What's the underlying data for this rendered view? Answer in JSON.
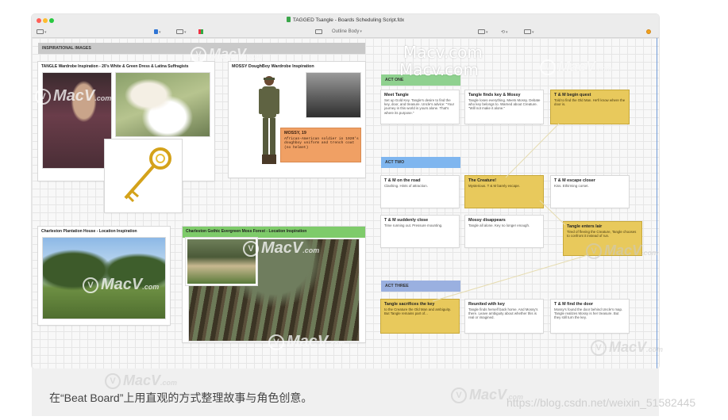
{
  "window": {
    "title": "TAGGED Tsangle - Boards Scheduling Script.fdx",
    "outline_label": "Outline Body"
  },
  "sections": {
    "inspirational": "INSPIRATIONAL IMAGES",
    "act_one": "ACT ONE",
    "act_two": "ACT TWO",
    "act_three": "ACT THREE"
  },
  "image_cards": {
    "tangle_wardrobe": "TANGLE Wardrobe Inspiration - 20's White & Green Dress & Latina Suffragists",
    "mossy_wardrobe": "MOSSY DoughBoy Wardrobe Inspiration",
    "charleston_plantation": "Charleston Plantation House - Location Inspiration",
    "charleston_gothic": "Charleston Gothic Evergreen Moss Forest - Location Inspiration"
  },
  "mossy_note": {
    "title": "MOSSY, 19",
    "body": "African-American soldier in 1920's doughboy uniform and trench coat (no helmet)"
  },
  "beats": {
    "meet_tangle": {
      "title": "Meet Tangle",
      "body": "Set up Gold Key. Tangle's desire to find the key, door, and treasure. Uncle's advice: \"Your journey in this world is yours alone. That's where its purpose.\""
    },
    "tangle_finds_key": {
      "title": "Tangle finds key & Mossy",
      "body": "Tangle loses everything. Meets Mossy. Debate who key belongs to. Warned about Creature. \"Will not make it alone.\""
    },
    "begin_quest": {
      "title": "T & M begin quest",
      "body": "Told to find the Old Man. He'll know where the door is."
    },
    "on_the_road": {
      "title": "T & M on the road",
      "body": "Clashing. Hints of attraction."
    },
    "the_creature": {
      "title": "The Creature!",
      "body": "Mysterious. T & M barely escape."
    },
    "t_m_escape": {
      "title": "T & M escape closer",
      "body": "Kiss. Ethirming corset."
    },
    "t_m_closer": {
      "title": "T & M suddenly close",
      "body": "Time running out. Pressure mounting."
    },
    "mossy_disappears": {
      "title": "Mossy disappears",
      "body": "Tangle all alone. Key no longer enough."
    },
    "tangle_lair": {
      "title": "Tangle enters lair",
      "body": "Tired of fleeing the Creature, Tangle chooses to confront it instead of run."
    },
    "tangle_sacrifices": {
      "title": "Tangle sacrifices the key",
      "body": "to the Creature the Old Man and ambiguity. But Tangle remains part of..."
    },
    "reunited": {
      "title": "Reunited with key",
      "body": "Tangle finds herself back home. And Mossy's there. Leave ambiguity about whether this is real or imagined."
    },
    "find_the_door": {
      "title": "T & M find the door",
      "body": "Mossy's found the door behind Uncle's map. Tangle realizes Mossy is her treasure. But they still turn the key."
    }
  },
  "caption": "在“Beat Board”上用直观的方式整理故事与角色创意。",
  "watermarks": {
    "brand": "MacV",
    "com": ".com",
    "site": "Macv.com",
    "csdn": "https://blog.csdn.net/weixin_51582445"
  },
  "icons": {
    "sidebar": "sidebar-icon",
    "grid": "grid-icon",
    "color": "color-palette-icon",
    "outline": "outline-icon",
    "cards": "cards-icon",
    "sync": "sync-icon",
    "layout": "layout-icon",
    "notification": "notification-icon"
  },
  "colors": {
    "inspirational_band": "#c9c9c9",
    "act_one_band": "#8fd18f",
    "act_two_band": "#7fb6ef",
    "act_three_band": "#9ab0e0",
    "gothic_band": "#7ecb6a",
    "yellow_card": "#e8c95c",
    "orange_note": "#f0a064"
  }
}
